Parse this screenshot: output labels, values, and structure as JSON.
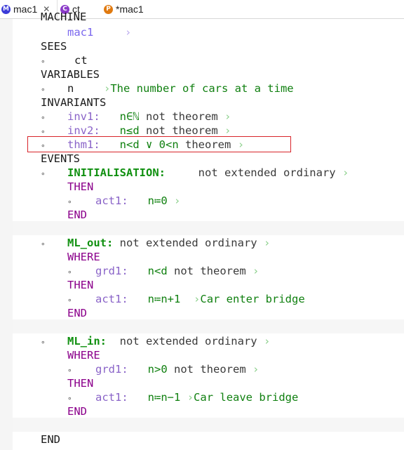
{
  "tabs": [
    {
      "label": "mac1",
      "icon": "M",
      "close": "✕",
      "active": true
    },
    {
      "label": "ct",
      "icon": "C"
    },
    {
      "label": "*mac1",
      "icon": "P"
    }
  ],
  "code": {
    "machine_kw": "MACHINE",
    "machine_name": "mac1",
    "sees_kw": "SEES",
    "sees_ctx": "ct",
    "variables_kw": "VARIABLES",
    "var_name": "n",
    "var_comment": "The number of cars at a time",
    "invariants_kw": "INVARIANTS",
    "inv1_label": "inv1:",
    "inv1_pred": "n∈ℕ",
    "inv1_suffix": "not theorem",
    "inv2_label": "inv2:",
    "inv2_pred": "n≤d",
    "inv2_suffix": "not theorem",
    "thm1_label": "thm1:",
    "thm1_pred": "n<d ∨ 0<n",
    "thm1_suffix": "theorem",
    "events_kw": "EVENTS",
    "init_name": "INITIALISATION:",
    "init_suffix": "not extended ordinary",
    "then_kw": "THEN",
    "init_act_label": "act1:",
    "init_act": "n≔0",
    "end_kw": "END",
    "mlout_name": "ML_out:",
    "mlout_suffix": "not extended ordinary",
    "where_kw": "WHERE",
    "mlout_grd_label": "grd1:",
    "mlout_grd": "n<d",
    "mlout_grd_suffix": "not theorem",
    "mlout_act_label": "act1:",
    "mlout_act": "n≔n+1",
    "mlout_act_comment": "Car enter bridge",
    "mlin_name": "ML_in:",
    "mlin_suffix": "not extended ordinary",
    "mlin_grd_label": "grd1:",
    "mlin_grd": "n>0",
    "mlin_grd_suffix": "not theorem",
    "mlin_act_label": "act1:",
    "mlin_act": "n≔n−1",
    "mlin_act_comment": "Car leave bridge",
    "final_end": "END",
    "bullet": "∘",
    "chevron": "›"
  },
  "colors": {
    "highlight_border": "#d8242a",
    "keyword_green": "#108010",
    "label_purple": "#8a64c8"
  }
}
